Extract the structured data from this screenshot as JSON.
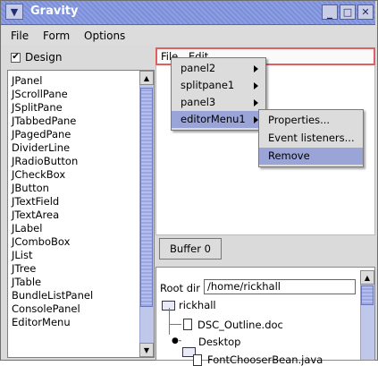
{
  "window": {
    "title": "Gravity",
    "minimize": "_",
    "maximize": "□",
    "close": "✕"
  },
  "menubar": {
    "items": [
      "File",
      "Form",
      "Options"
    ]
  },
  "design": {
    "label": "Design",
    "checked": "✔"
  },
  "component_list": {
    "items": [
      "JPanel",
      "JScrollPane",
      "JSplitPane",
      "JTabbedPane",
      "JPagedPane",
      "DividerLine",
      "JRadioButton",
      "JCheckBox",
      "JButton",
      "JTextField",
      "JTextArea",
      "JLabel",
      "JComboBox",
      "JList",
      "JTree",
      "JTable",
      "BundleListPanel",
      "ConsolePanel",
      "EditorMenu"
    ]
  },
  "editor_menubar": {
    "items": [
      "File",
      "Edit"
    ]
  },
  "popup_menu": {
    "items": [
      "panel2",
      "splitpane1",
      "panel3",
      "editorMenu1"
    ],
    "selected": "editorMenu1"
  },
  "submenu": {
    "items": [
      "Properties...",
      "Event listeners...",
      "Remove"
    ],
    "selected": "Remove"
  },
  "buffer": {
    "label": "Buffer 0"
  },
  "file_browser": {
    "root_label": "Root dir",
    "root_value": "/home/rickhall",
    "tree": [
      "rickhall",
      "DSC_Outline.doc",
      "Desktop",
      "FontChooserBean.java"
    ]
  }
}
